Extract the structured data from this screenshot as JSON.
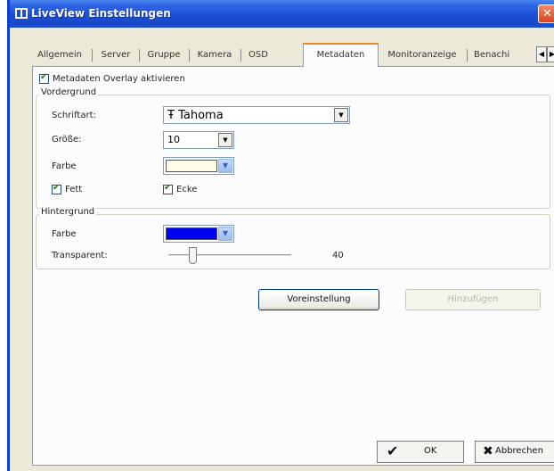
{
  "window": {
    "title": "LiveView Einstellungen",
    "close_glyph": "✕"
  },
  "tabs": [
    {
      "label": "Allgemein",
      "active": false
    },
    {
      "label": "Server",
      "active": false
    },
    {
      "label": "Gruppe",
      "active": false
    },
    {
      "label": "Kamera",
      "active": false
    },
    {
      "label": "OSD",
      "active": false
    },
    {
      "label": "Metadaten",
      "active": true
    },
    {
      "label": "Monitoranzeige",
      "active": false
    },
    {
      "label": "Benachi",
      "active": false
    }
  ],
  "tab_scroll": {
    "left": "◀",
    "right": "▶"
  },
  "metadata": {
    "overlay_checkbox_label": "Metadaten Overlay aktivieren",
    "overlay_checked": true,
    "foreground": {
      "legend": "Vordergrund",
      "font_label": "Schriftart:",
      "font_value": "Tahoma",
      "font_glyph": "Ŧ",
      "size_label": "Größe:",
      "size_value": "10",
      "color_label": "Farbe",
      "color_value": "#fffde8",
      "bold_label": "Fett",
      "bold_checked": true,
      "corner_label": "Ecke",
      "corner_checked": true
    },
    "background": {
      "legend": "Hintergrund",
      "color_label": "Farbe",
      "color_value": "#0000f0",
      "transparency_label": "Transparent:",
      "transparency_value": "40",
      "transparency_fraction": 0.2
    }
  },
  "buttons": {
    "preset_label": "Voreinstellung",
    "add_label": "Hinzufügen",
    "ok_label": "OK",
    "cancel_label": "Abbrechen",
    "ok_glyph": "✔",
    "cancel_glyph": "✖"
  },
  "glyphs": {
    "check": "✔",
    "dropdown": "▼"
  },
  "colors": {
    "title_bar": "#1c4fd6",
    "active_tab_accent": "#e68b2c",
    "window_bg": "#ece9d8",
    "panel_bg": "#fcfcfe"
  }
}
